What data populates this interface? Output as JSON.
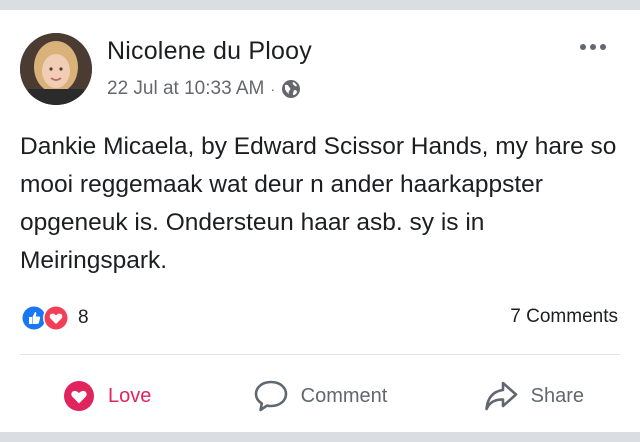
{
  "post": {
    "author": "Nicolene du Plooy",
    "timestamp": "22 Jul at 10:33 AM",
    "separator": "·",
    "privacy_icon": "globe-icon",
    "text": "Dankie Micaela, by Edward Scissor Hands, my hare so mooi reggemaak wat deur n ander haarkappster opgeneuk is. Ondersteun haar asb. sy is in Meiringspark.",
    "reactions": {
      "icons": [
        "like-reaction-icon",
        "love-reaction-icon"
      ],
      "count": "8"
    },
    "comments_label": "7 Comments"
  },
  "actions": {
    "love_label": "Love",
    "comment_label": "Comment",
    "share_label": "Share"
  },
  "colors": {
    "love": "#e0245e",
    "like": "#1877f2",
    "muted": "#65676b",
    "text": "#1c1e21"
  }
}
